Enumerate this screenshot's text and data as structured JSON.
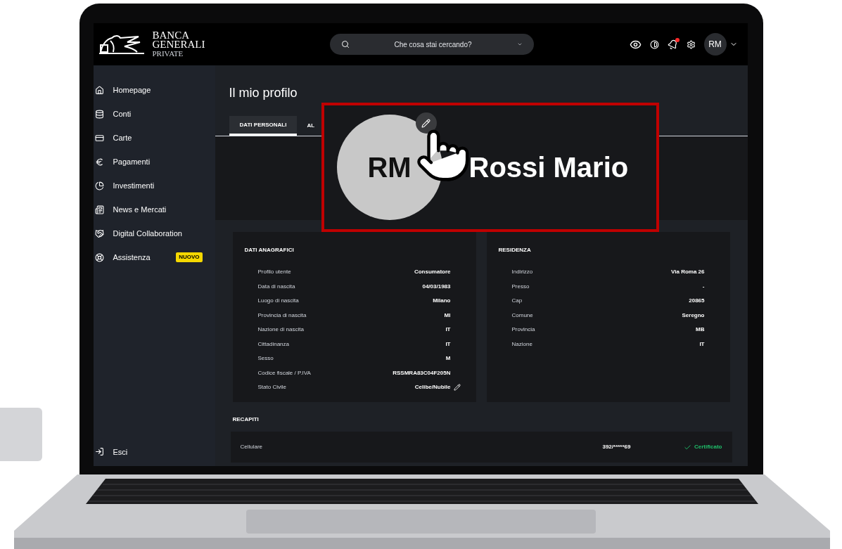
{
  "header": {
    "logo": {
      "lines": [
        "BANCA",
        "GENERALI",
        "PRIVATE"
      ]
    },
    "search": {
      "placeholder": "Che cosa stai cercando?"
    },
    "has_notification": true,
    "avatar": "RM"
  },
  "sidebar": {
    "items": [
      {
        "label": "Homepage",
        "kind": "home"
      },
      {
        "label": "Conti",
        "kind": "accounts"
      },
      {
        "label": "Carte",
        "kind": "cards"
      },
      {
        "label": "Pagamenti",
        "kind": "payments"
      },
      {
        "label": "Investimenti",
        "kind": "investments"
      },
      {
        "label": "News e Mercati",
        "kind": "news"
      },
      {
        "label": "Digital Collaboration",
        "kind": "collab"
      },
      {
        "label": "Assistenza",
        "kind": "help",
        "badge": "NUOVO"
      }
    ],
    "footer": "Esci"
  },
  "page": {
    "title": "Il mio profilo",
    "tabs": [
      {
        "label": "DATI PERSONALI",
        "selected": true
      },
      {
        "label": "AL",
        "selected": false
      }
    ]
  },
  "profile_overlay": {
    "initials": "RM",
    "name": "Rossi Mario"
  },
  "sections": [
    {
      "title": "DATI ANAGRAFICI",
      "rows": [
        {
          "label": "Profilo utente",
          "value": "Consumatore",
          "editable": false
        },
        {
          "label": "Data di nascita",
          "value": "04/03/1983",
          "editable": false
        },
        {
          "label": "Luogo di nascita",
          "value": "Milano",
          "editable": false
        },
        {
          "label": "Provincia di nascita",
          "value": "MI",
          "editable": false
        },
        {
          "label": "Nazione di nascita",
          "value": "IT",
          "editable": false
        },
        {
          "label": "Cittadinanza",
          "value": "IT",
          "editable": false
        },
        {
          "label": "Sesso",
          "value": "M",
          "editable": false
        },
        {
          "label": "Codice fiscale / P.IVA",
          "value": "RSSMRA83C04F205N",
          "editable": false
        },
        {
          "label": "Stato Civile",
          "value": "Celibe/Nubile",
          "editable": true
        }
      ]
    },
    {
      "title": "RESIDENZA",
      "rows": [
        {
          "label": "Indirizzo",
          "value": "Via Roma 26",
          "editable": false
        },
        {
          "label": "Presso",
          "value": "-",
          "editable": false
        },
        {
          "label": "Cap",
          "value": "20865",
          "editable": false
        },
        {
          "label": "Comune",
          "value": "Seregno",
          "editable": false
        },
        {
          "label": "Provincia",
          "value": "MB",
          "editable": false
        },
        {
          "label": "Nazione",
          "value": "IT",
          "editable": false
        }
      ]
    }
  ],
  "contacts": {
    "title": "RECAPITI",
    "rows": [
      {
        "label": "Cellulare",
        "value": "392/*****69",
        "status": "Certificato",
        "certified": true
      }
    ]
  }
}
